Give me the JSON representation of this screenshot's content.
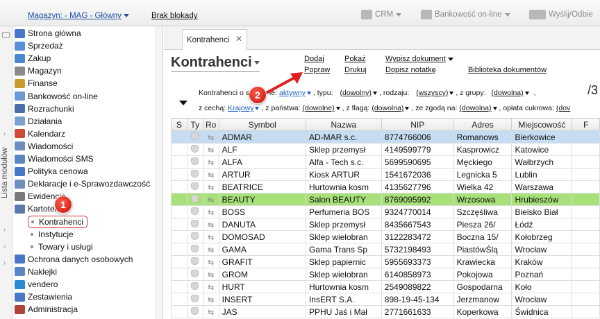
{
  "topbar": {
    "magazyn": "Magazyn: - MAG - Główny",
    "brak_blokady": "Brak blokady",
    "crm": "CRM",
    "bankowosc": "Bankowość on-line",
    "wyslij": "Wyślij/Odbie"
  },
  "vstrip": {
    "label": "Lista modułów"
  },
  "sidebar": {
    "items": [
      {
        "label": "Strona główna",
        "icon": "home-icon",
        "color": "#4a78c8"
      },
      {
        "label": "Sprzedaż",
        "icon": "cart-icon",
        "color": "#5b8fd6"
      },
      {
        "label": "Zakup",
        "icon": "purchase-icon",
        "color": "#4f86d0"
      },
      {
        "label": "Magazyn",
        "icon": "warehouse-icon",
        "color": "#8a8a8a"
      },
      {
        "label": "Finanse",
        "icon": "finance-icon",
        "color": "#c99a2e"
      },
      {
        "label": "Bankowość on-line",
        "icon": "bank-icon",
        "color": "#6a9ad6"
      },
      {
        "label": "Rozrachunki",
        "icon": "settlements-icon",
        "color": "#4a6fa8"
      },
      {
        "label": "Działania",
        "icon": "actions-icon",
        "color": "#7aa0d0"
      },
      {
        "label": "Kalendarz",
        "icon": "calendar-icon",
        "color": "#d04a3a"
      },
      {
        "label": "Wiadomości",
        "icon": "message-icon",
        "color": "#6d8fc0"
      },
      {
        "label": "Wiadomości SMS",
        "icon": "sms-icon",
        "color": "#5a86c2"
      },
      {
        "label": "Polityka cenowa",
        "icon": "pricing-icon",
        "color": "#4a78c8"
      },
      {
        "label": "Deklaracje i e-Sprawozdawczość",
        "icon": "declaration-icon",
        "color": "#6a90c0"
      },
      {
        "label": "Ewidencje",
        "icon": "records-icon",
        "color": "#7a7a7a"
      },
      {
        "label": "Kartoteki",
        "icon": "cards-icon",
        "color": "#5a7ab0"
      }
    ],
    "sub": [
      {
        "label": "Kontrahenci"
      },
      {
        "label": "Instytucje"
      },
      {
        "label": "Towary i usługi"
      }
    ],
    "items2": [
      {
        "label": "Ochrona danych osobowych",
        "icon": "shield-icon",
        "color": "#4a78c8"
      },
      {
        "label": "Naklejki",
        "icon": "sticker-icon",
        "color": "#5a86c2"
      },
      {
        "label": "vendero",
        "icon": "vendero-icon",
        "color": "#2a8ad4"
      },
      {
        "label": "Zestawienia",
        "icon": "report-icon",
        "color": "#4a78c8"
      },
      {
        "label": "Administracja",
        "icon": "admin-icon",
        "color": "#b0453a"
      }
    ]
  },
  "tab": {
    "label": "Kontrahenci",
    "close": "✕"
  },
  "page": {
    "title": "Kontrahenci"
  },
  "actions": {
    "dodaj": "Dodaj",
    "popraw": "Popraw",
    "pokaz": "Pokaż",
    "drukuj": "Drukuj",
    "wypisz": "Wypisz dokument",
    "dopisz": "Dopisz notatkę",
    "biblioteka": "Biblioteka dokumentów"
  },
  "filters": {
    "row1_lead": "Kontrahenci o st",
    "row1_lead2": "ie:",
    "status": "aktywny",
    "typ_label": ", typu:",
    "typ": "(dowolny)",
    "rodzaj_label": ", rodzaju:",
    "rodzaj": "(wszyscy)",
    "grupa_label": ", z grupy:",
    "grupa": "(dowolna)",
    "trail": ",",
    "cecha_label": "z cechą:",
    "cecha": "Krajowy",
    "panstwo_label": ", z państwa:",
    "panstwo": "(dowolne)",
    "flaga_label": ", z flagą:",
    "flaga": "(dowolna)",
    "zgoda_label": ", ze zgodą na:",
    "zgoda": "(dowolna)",
    "oplata_label": ", opłata cukrowa:",
    "oplata": "(dov",
    "slash": "/3"
  },
  "table": {
    "headers": [
      "S",
      "Ty",
      "Ro",
      "Symbol",
      "Nazwa",
      "NIP",
      "Adres",
      "Miejscowość",
      "F"
    ],
    "rows": [
      {
        "symbol": "ADMAR",
        "nazwa": "AD-MAR s.c.",
        "nip": "8774766006",
        "adres": "Romanows",
        "miejsc": "Bierkowice",
        "state": "sel"
      },
      {
        "symbol": "ALF",
        "nazwa": "Sklep przemysł",
        "nip": "4149599779",
        "adres": "Kasprowicz",
        "miejsc": "Katowice",
        "state": ""
      },
      {
        "symbol": "ALFA",
        "nazwa": "Alfa - Tech s.c.",
        "nip": "5699590695",
        "adres": "Męckiego",
        "miejsc": "Wałbrzych",
        "state": ""
      },
      {
        "symbol": "ARTUR",
        "nazwa": "Kiosk ARTUR",
        "nip": "1541672036",
        "adres": "Legnicka 5",
        "miejsc": "Lublin",
        "state": ""
      },
      {
        "symbol": "BEATRICE",
        "nazwa": "Hurtownia kosm",
        "nip": "4135627796",
        "adres": "Wielka 42",
        "miejsc": "Warszawa",
        "state": ""
      },
      {
        "symbol": "BEAUTY",
        "nazwa": "Salon BEAUTY",
        "nip": "8769095992",
        "adres": "Wrzosowa",
        "miejsc": "Hrubieszów",
        "state": "hl"
      },
      {
        "symbol": "BOSS",
        "nazwa": "Perfumeria BOS",
        "nip": "9324770014",
        "adres": "Szczęśliwa",
        "miejsc": "Bielsko Biał",
        "state": ""
      },
      {
        "symbol": "DANUTA",
        "nazwa": "Sklep przemysł",
        "nip": "8435667543",
        "adres": "Piesza 26/",
        "miejsc": "Łódź",
        "state": ""
      },
      {
        "symbol": "DOMOSAD",
        "nazwa": "Sklep wielobran",
        "nip": "3122283472",
        "adres": "Boczna 15/",
        "miejsc": "Kołobrzeg",
        "state": ""
      },
      {
        "symbol": "GAMA",
        "nazwa": "Gama Trans Sp",
        "nip": "5732198493",
        "adres": "PiastówŚlą",
        "miejsc": "Wrocław",
        "state": ""
      },
      {
        "symbol": "GRAFIT",
        "nazwa": "Sklep papiernic",
        "nip": "5955693373",
        "adres": "Krawiecka",
        "miejsc": "Kraków",
        "state": ""
      },
      {
        "symbol": "GROM",
        "nazwa": "Sklep wielobran",
        "nip": "6140858973",
        "adres": "Pokojowa",
        "miejsc": "Poznań",
        "state": ""
      },
      {
        "symbol": "HURT",
        "nazwa": "Hurtownia kosm",
        "nip": "2549089822",
        "adres": "Gospodarna",
        "miejsc": "Koło",
        "state": ""
      },
      {
        "symbol": "INSERT",
        "nazwa": "InsERT S.A.",
        "nip": "898-19-45-134",
        "adres": "Jerzmanow",
        "miejsc": "Wrocław",
        "state": ""
      },
      {
        "symbol": "JAS",
        "nazwa": "PPHU Jaś i Mał",
        "nip": "2771661633",
        "adres": "Koperkowa",
        "miejsc": "Świdnica",
        "state": ""
      }
    ]
  },
  "annotations": {
    "badge1": "1",
    "badge2": "2",
    "accent": "#e02020"
  }
}
